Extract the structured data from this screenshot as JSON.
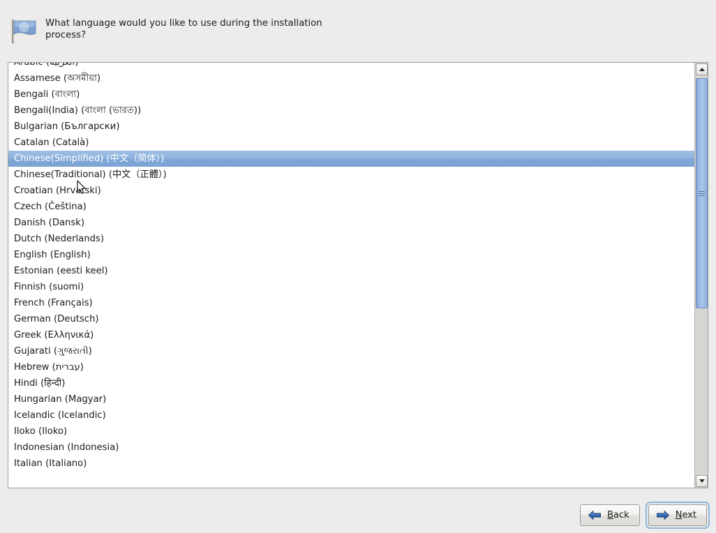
{
  "header": {
    "icon": "un-flag-icon",
    "prompt": "What language would you like to use during the installation process?"
  },
  "language_list": {
    "name": "language-list",
    "selected_index": 6,
    "partial_top_row": true,
    "partial_bottom_row": true,
    "items": [
      {
        "label": "Arabic (العربية)"
      },
      {
        "label": "Assamese (অসমীয়া)"
      },
      {
        "label": "Bengali (বাংলা)"
      },
      {
        "label": "Bengali(India) (বাংলা (ভারত))"
      },
      {
        "label": "Bulgarian (Български)"
      },
      {
        "label": "Catalan (Català)"
      },
      {
        "label": "Chinese(Simplified) (中文（简体）)"
      },
      {
        "label": "Chinese(Traditional) (中文（正體）)"
      },
      {
        "label": "Croatian (Hrvatski)"
      },
      {
        "label": "Czech (Čeština)"
      },
      {
        "label": "Danish (Dansk)"
      },
      {
        "label": "Dutch (Nederlands)"
      },
      {
        "label": "English (English)"
      },
      {
        "label": "Estonian (eesti keel)"
      },
      {
        "label": "Finnish (suomi)"
      },
      {
        "label": "French (Français)"
      },
      {
        "label": "German (Deutsch)"
      },
      {
        "label": "Greek (Ελληνικά)"
      },
      {
        "label": "Gujarati (ગુજરાતી)"
      },
      {
        "label": "Hebrew (עברית)"
      },
      {
        "label": "Hindi (हिन्दी)"
      },
      {
        "label": "Hungarian (Magyar)"
      },
      {
        "label": "Icelandic (Icelandic)"
      },
      {
        "label": "Iloko (Iloko)"
      },
      {
        "label": "Indonesian (Indonesia)"
      },
      {
        "label": "Italian (Italiano)"
      }
    ]
  },
  "scrollbar": {
    "name": "vertical-scrollbar",
    "up_icon": "chevron-up-icon",
    "down_icon": "chevron-down-icon",
    "thumb": "scrollbar-thumb"
  },
  "buttons": [
    {
      "name": "back-button",
      "icon": "arrow-left-icon",
      "mnemonic": "B",
      "rest": "ack",
      "focused": false
    },
    {
      "name": "next-button",
      "icon": "arrow-right-icon",
      "mnemonic": "N",
      "rest": "ext",
      "focused": true
    }
  ],
  "colors": {
    "window_background": "#ececec",
    "list_background": "#ffffff",
    "selection_start": "#9ebfe4",
    "selection_end": "#7ba3d3",
    "selection_text": "#ffffff",
    "scrollbar_thumb": "#a8c3ec",
    "scrollbar_trough": "#d8d6d2",
    "focus_ring": "#8eb4dd",
    "text": "#1a1a1a"
  }
}
